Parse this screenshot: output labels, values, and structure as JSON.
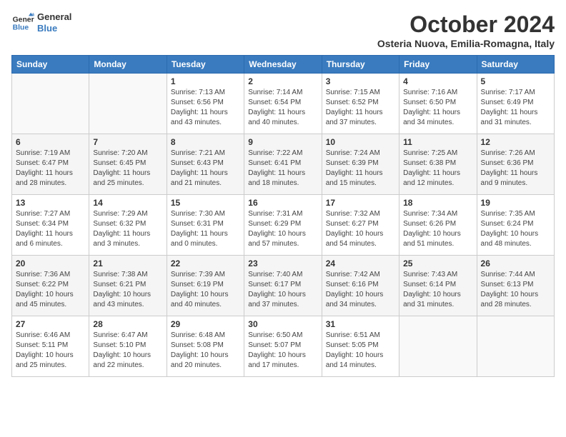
{
  "header": {
    "logo_line1": "General",
    "logo_line2": "Blue",
    "month": "October 2024",
    "location": "Osteria Nuova, Emilia-Romagna, Italy"
  },
  "days_of_week": [
    "Sunday",
    "Monday",
    "Tuesday",
    "Wednesday",
    "Thursday",
    "Friday",
    "Saturday"
  ],
  "weeks": [
    [
      {
        "day": "",
        "info": ""
      },
      {
        "day": "",
        "info": ""
      },
      {
        "day": "1",
        "info": "Sunrise: 7:13 AM\nSunset: 6:56 PM\nDaylight: 11 hours and 43 minutes."
      },
      {
        "day": "2",
        "info": "Sunrise: 7:14 AM\nSunset: 6:54 PM\nDaylight: 11 hours and 40 minutes."
      },
      {
        "day": "3",
        "info": "Sunrise: 7:15 AM\nSunset: 6:52 PM\nDaylight: 11 hours and 37 minutes."
      },
      {
        "day": "4",
        "info": "Sunrise: 7:16 AM\nSunset: 6:50 PM\nDaylight: 11 hours and 34 minutes."
      },
      {
        "day": "5",
        "info": "Sunrise: 7:17 AM\nSunset: 6:49 PM\nDaylight: 11 hours and 31 minutes."
      }
    ],
    [
      {
        "day": "6",
        "info": "Sunrise: 7:19 AM\nSunset: 6:47 PM\nDaylight: 11 hours and 28 minutes."
      },
      {
        "day": "7",
        "info": "Sunrise: 7:20 AM\nSunset: 6:45 PM\nDaylight: 11 hours and 25 minutes."
      },
      {
        "day": "8",
        "info": "Sunrise: 7:21 AM\nSunset: 6:43 PM\nDaylight: 11 hours and 21 minutes."
      },
      {
        "day": "9",
        "info": "Sunrise: 7:22 AM\nSunset: 6:41 PM\nDaylight: 11 hours and 18 minutes."
      },
      {
        "day": "10",
        "info": "Sunrise: 7:24 AM\nSunset: 6:39 PM\nDaylight: 11 hours and 15 minutes."
      },
      {
        "day": "11",
        "info": "Sunrise: 7:25 AM\nSunset: 6:38 PM\nDaylight: 11 hours and 12 minutes."
      },
      {
        "day": "12",
        "info": "Sunrise: 7:26 AM\nSunset: 6:36 PM\nDaylight: 11 hours and 9 minutes."
      }
    ],
    [
      {
        "day": "13",
        "info": "Sunrise: 7:27 AM\nSunset: 6:34 PM\nDaylight: 11 hours and 6 minutes."
      },
      {
        "day": "14",
        "info": "Sunrise: 7:29 AM\nSunset: 6:32 PM\nDaylight: 11 hours and 3 minutes."
      },
      {
        "day": "15",
        "info": "Sunrise: 7:30 AM\nSunset: 6:31 PM\nDaylight: 11 hours and 0 minutes."
      },
      {
        "day": "16",
        "info": "Sunrise: 7:31 AM\nSunset: 6:29 PM\nDaylight: 10 hours and 57 minutes."
      },
      {
        "day": "17",
        "info": "Sunrise: 7:32 AM\nSunset: 6:27 PM\nDaylight: 10 hours and 54 minutes."
      },
      {
        "day": "18",
        "info": "Sunrise: 7:34 AM\nSunset: 6:26 PM\nDaylight: 10 hours and 51 minutes."
      },
      {
        "day": "19",
        "info": "Sunrise: 7:35 AM\nSunset: 6:24 PM\nDaylight: 10 hours and 48 minutes."
      }
    ],
    [
      {
        "day": "20",
        "info": "Sunrise: 7:36 AM\nSunset: 6:22 PM\nDaylight: 10 hours and 45 minutes."
      },
      {
        "day": "21",
        "info": "Sunrise: 7:38 AM\nSunset: 6:21 PM\nDaylight: 10 hours and 43 minutes."
      },
      {
        "day": "22",
        "info": "Sunrise: 7:39 AM\nSunset: 6:19 PM\nDaylight: 10 hours and 40 minutes."
      },
      {
        "day": "23",
        "info": "Sunrise: 7:40 AM\nSunset: 6:17 PM\nDaylight: 10 hours and 37 minutes."
      },
      {
        "day": "24",
        "info": "Sunrise: 7:42 AM\nSunset: 6:16 PM\nDaylight: 10 hours and 34 minutes."
      },
      {
        "day": "25",
        "info": "Sunrise: 7:43 AM\nSunset: 6:14 PM\nDaylight: 10 hours and 31 minutes."
      },
      {
        "day": "26",
        "info": "Sunrise: 7:44 AM\nSunset: 6:13 PM\nDaylight: 10 hours and 28 minutes."
      }
    ],
    [
      {
        "day": "27",
        "info": "Sunrise: 6:46 AM\nSunset: 5:11 PM\nDaylight: 10 hours and 25 minutes."
      },
      {
        "day": "28",
        "info": "Sunrise: 6:47 AM\nSunset: 5:10 PM\nDaylight: 10 hours and 22 minutes."
      },
      {
        "day": "29",
        "info": "Sunrise: 6:48 AM\nSunset: 5:08 PM\nDaylight: 10 hours and 20 minutes."
      },
      {
        "day": "30",
        "info": "Sunrise: 6:50 AM\nSunset: 5:07 PM\nDaylight: 10 hours and 17 minutes."
      },
      {
        "day": "31",
        "info": "Sunrise: 6:51 AM\nSunset: 5:05 PM\nDaylight: 10 hours and 14 minutes."
      },
      {
        "day": "",
        "info": ""
      },
      {
        "day": "",
        "info": ""
      }
    ]
  ]
}
